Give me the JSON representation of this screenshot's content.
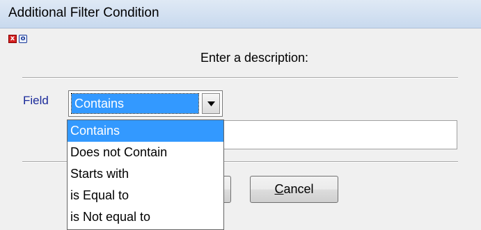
{
  "window": {
    "title": "Additional Filter Condition"
  },
  "controls": {
    "close_glyph": "x",
    "option_glyph": "o"
  },
  "dialog": {
    "prompt": "Enter a description:",
    "field_label": "Field",
    "combo_value": "Contains",
    "description_value": ""
  },
  "dropdown": {
    "options": [
      "Contains",
      "Does not Contain",
      "Starts with",
      "is Equal to",
      "is Not equal to"
    ],
    "selected_index": 0
  },
  "buttons": {
    "ok_label": "",
    "cancel_mnemonic": "C",
    "cancel_rest": "ancel"
  },
  "icons": {
    "combo_arrow": "chevron-down-icon",
    "close": "close-icon",
    "option": "option-icon"
  }
}
